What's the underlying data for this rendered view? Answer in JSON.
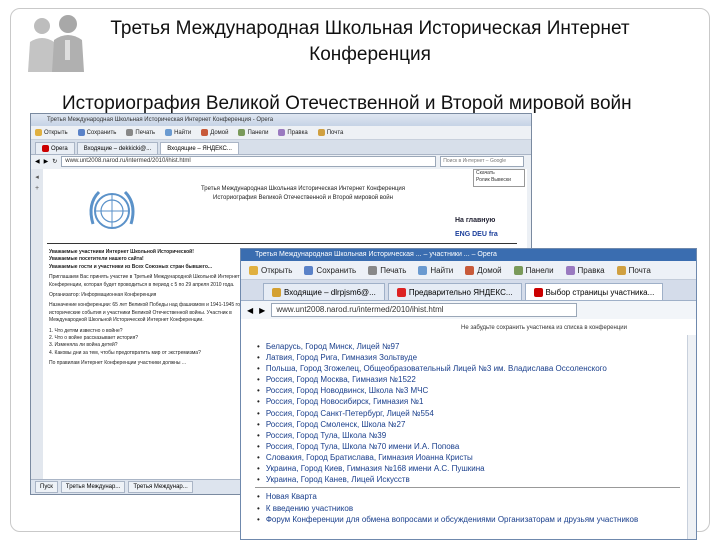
{
  "slide": {
    "title": "Третья Международная Школьная Историческая Интернет Конференция",
    "subtitle": "Историография Великой Отечественной и Второй мировой войн"
  },
  "window1": {
    "title": "Третья Международная Школьная Историческая Интернет Конференция - Opera",
    "toolbar": [
      "Открыть",
      "Сохранить",
      "Печать",
      "Найти",
      "Домой",
      "Панели",
      "Правка",
      "Почта"
    ],
    "tabs": [
      "Opera",
      "Входящие – dekkicki@...",
      "Входящие – ЯНДЕКС..."
    ],
    "address": "www.unt2008.narod.ru/intermed/2010/ihist.html",
    "search_placeholder": "Поиск в Интернет – Google",
    "popup": [
      "Скачать",
      "Ролик Вывески"
    ],
    "conference_header": "Третья Международная Школьная Историческая Интернет Конференция",
    "conference_topic": "Историография Великой Отечественной и Второй мировой войн",
    "lang_link": "На главную",
    "lang_codes": "ENG DEU fra",
    "body": [
      "Уважаемые участники Интернет Школьной Исторической!",
      "Уважаемые посетители нашего сайта!",
      "Уважаемые гости и участники из Всех Союзных стран бывшего...",
      "Приглашаем Вас принять участие в Третьей Международной Школьной Интернет Конференции, которая будет проводиться в период с 5 по 29 апреля 2010 года.",
      "Организатор: Информационная Конференция",
      "Назначение конференции: 65 лет Великой Победы над фашизмом и 1941-1945 годы: исторические события и участники Великой Отечественной войны. Участник в Международной Школьной Исторической Интернет Конференции.",
      "1. Что детям известно о войне?",
      "2. Что о войне рассказывает история?",
      "3. Изменяла ли война детей?",
      "4. Каковы дни за тем, чтобы предотвратить мир от экстремизма?",
      "По правилам Интернет Конференции участники должны ..."
    ],
    "status_tasks": [
      "Пуск",
      "Третья Междунар...",
      "Третья Междунар..."
    ]
  },
  "window2": {
    "title": "Третья Международная Школьная Историческая ... – участники ... – Opera",
    "toolbar": [
      "Открыть",
      "Сохранить",
      "Печать",
      "Найти",
      "Домой",
      "Панели",
      "Правка",
      "Почта"
    ],
    "tabs": [
      "Входящие – dlrpjsm6@...",
      "Предварительно ЯНДЕКС...",
      "Выбор страницы участника..."
    ],
    "address": "www.unt2008.narod.ru/intermed/2010/ihist.html",
    "note": "Не забудьте сохранить участника из списка в конференции",
    "participants": [
      "Беларусь, Город Минск, Лицей №97",
      "Латвия, Город Рига, Гимназия Зольтвуде",
      "Польша, Город Згожелец, Общеобразовательный Лицей №3 им. Владислава Оссоленского",
      "Россия, Город Москва, Гимназия №1522",
      "Россия, Город Новодвинск, Школа №3 МЧС",
      "Россия, Город Новосибирск, Гимназия №1",
      "Россия, Город Санкт-Петербург, Лицей №554",
      "Россия, Город Смоленск, Школа №27",
      "Россия, Город Тула, Школа №39",
      "Россия, Город Тула, Школа №70 имени И.А. Попова",
      "Словакия, Город Братислава, Гимназия Иоанна Кристы",
      "Украина, Город Киев, Гимназия №168 имени А.С. Пушкина",
      "Украина, Город Канев, Лицей Искусств"
    ],
    "links": [
      "Новая Кварта",
      "К введению участников",
      "Форум Конференции для обмена вопросами и обсуждениями Организаторам и друзьям участников"
    ]
  },
  "colors": {
    "frame_border": "#c9c9c9",
    "window2_title_bar": "#3a6db0",
    "link_blue": "#1a3f8c"
  }
}
